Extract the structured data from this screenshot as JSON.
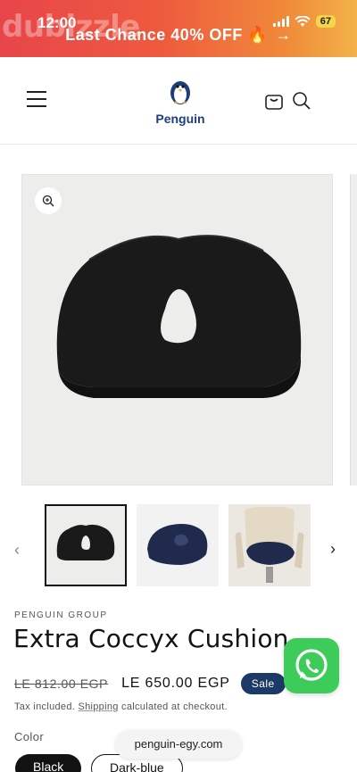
{
  "status_bar": {
    "time": "12:00",
    "battery": "67"
  },
  "watermark": "dubizzle",
  "announcement": {
    "text": "Last Chance 40% OFF 🔥",
    "arrow": "→"
  },
  "header": {
    "logo_text": "Penguin",
    "icons": [
      "menu-icon",
      "cart-icon",
      "search-icon"
    ]
  },
  "gallery": {
    "thumbnails": [
      "Black cushion",
      "Dark-blue cushion",
      "Dark-blue cushion on office chair"
    ],
    "prev": "‹",
    "next": "›"
  },
  "product": {
    "vendor": "PENGUIN GROUP",
    "title": "Extra Coccyx Cushion",
    "price_old": "LE 812.00 EGP",
    "price_new": "LE 650.00 EGP",
    "badge": "Sale",
    "tax_prefix": "Tax included.",
    "tax_link": "Shipping",
    "tax_suffix": "calculated at checkout.",
    "color_label": "Color",
    "color_options": [
      "Black",
      "Dark-blue"
    ]
  },
  "url_bar": {
    "domain": "penguin-egy.com"
  },
  "colors": {
    "brand_blue": "#1d3f79",
    "sale_badge": "#1c3a66",
    "whatsapp": "#3dcc5a"
  }
}
